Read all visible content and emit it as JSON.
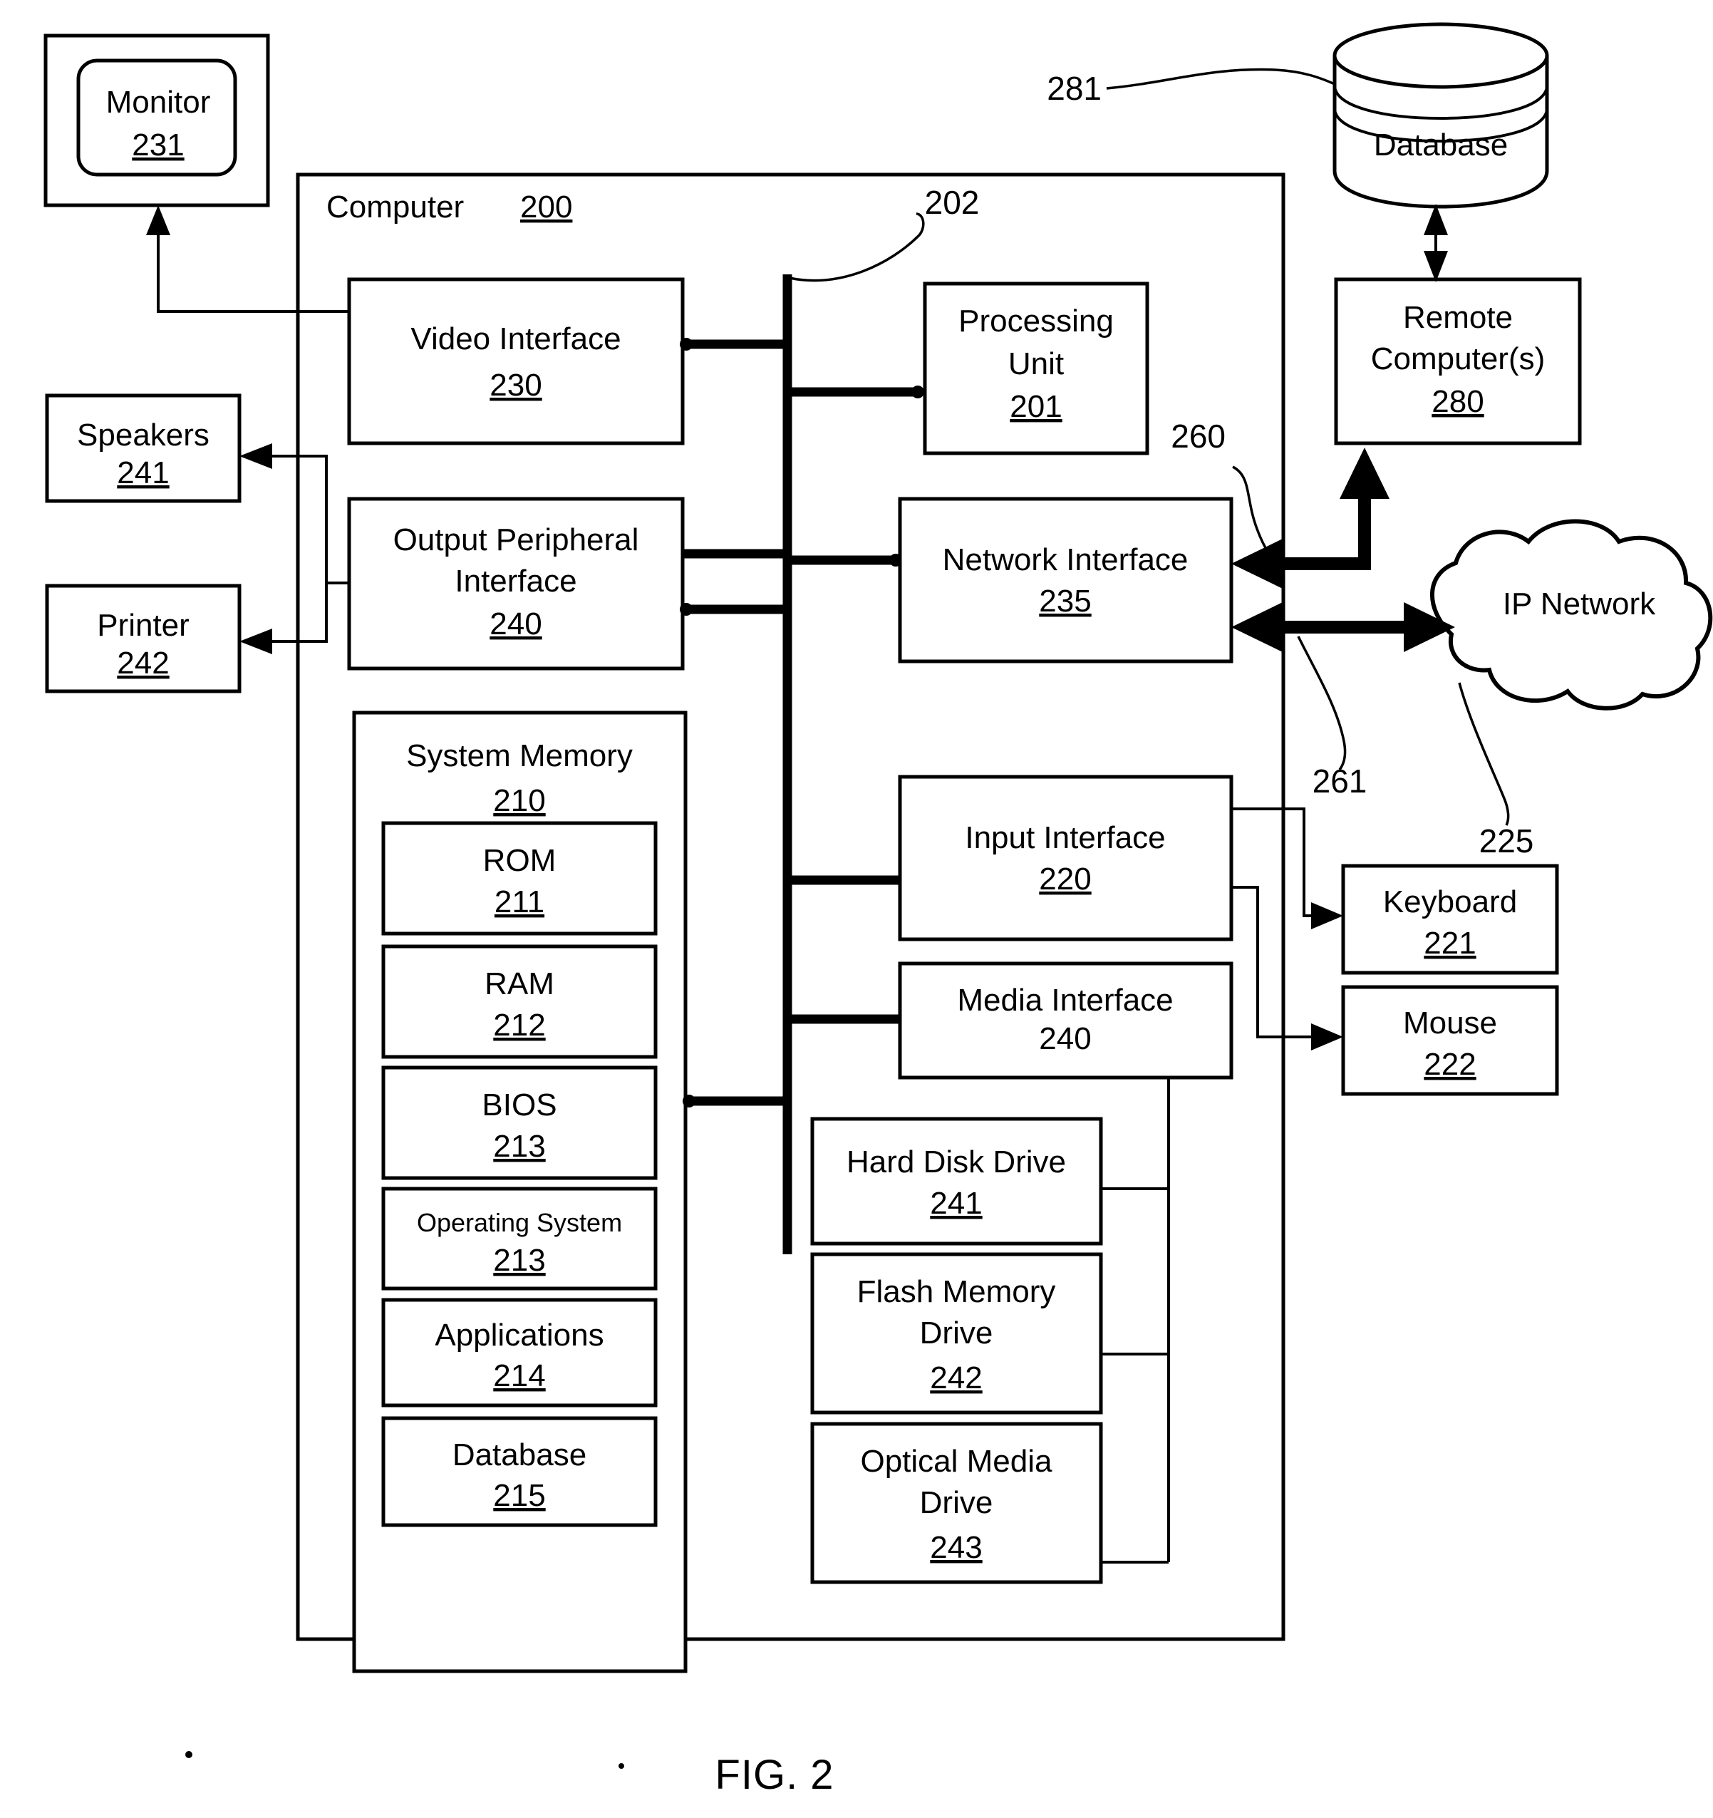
{
  "figure": {
    "caption": "FIG. 2",
    "title_label": "Computer",
    "title_number": "200"
  },
  "reference_numerals": {
    "bus": "202",
    "network_link_to_remote": "260",
    "network_link_to_ip": "261",
    "ip_network_ref": "225",
    "database_ref": "281"
  },
  "blocks": {
    "monitor": {
      "label": "Monitor",
      "number": "231",
      "underline": true
    },
    "speakers": {
      "label": "Speakers",
      "number": "241",
      "underline": true
    },
    "printer": {
      "label": "Printer",
      "number": "242",
      "underline": true
    },
    "video_interface": {
      "label": "Video Interface",
      "number": "230",
      "underline": true
    },
    "output_peripheral": {
      "label_line1": "Output Peripheral",
      "label_line2": "Interface",
      "number": "240",
      "underline": true
    },
    "system_memory": {
      "label": "System Memory",
      "number": "210",
      "underline": true
    },
    "rom": {
      "label": "ROM",
      "number": "211",
      "underline": true
    },
    "ram": {
      "label": "RAM",
      "number": "212",
      "underline": true
    },
    "bios": {
      "label": "BIOS",
      "number": "213",
      "underline": true
    },
    "operating_system": {
      "label": "Operating System",
      "number": "213",
      "underline": true,
      "small": true
    },
    "applications": {
      "label": "Applications",
      "number": "214",
      "underline": true
    },
    "database_mem": {
      "label": "Database",
      "number": "215",
      "underline": true
    },
    "processing_unit": {
      "label_line1": "Processing",
      "label_line2": "Unit",
      "number": "201",
      "underline": true
    },
    "network_interface": {
      "label": "Network Interface",
      "number": "235",
      "underline": true
    },
    "input_interface": {
      "label": "Input Interface",
      "number": "220",
      "underline": true
    },
    "media_interface": {
      "label": "Media Interface",
      "number": "240",
      "underline": false
    },
    "keyboard": {
      "label": "Keyboard",
      "number": "221",
      "underline": true
    },
    "mouse": {
      "label": "Mouse",
      "number": "222",
      "underline": true
    },
    "hard_disk_drive": {
      "label": "Hard Disk Drive",
      "number": "241",
      "underline": true
    },
    "flash_memory_drive": {
      "label_line1": "Flash Memory",
      "label_line2": "Drive",
      "number": "242",
      "underline": true
    },
    "optical_media_drive": {
      "label_line1": "Optical Media",
      "label_line2": "Drive",
      "number": "243",
      "underline": true
    },
    "remote_computer": {
      "label_line1": "Remote",
      "label_line2": "Computer(s)",
      "number": "280",
      "underline": true
    },
    "database_remote": {
      "label": "Database"
    },
    "ip_network": {
      "label": "IP Network"
    }
  },
  "colors": {
    "stroke": "#000000",
    "background": "#ffffff"
  }
}
